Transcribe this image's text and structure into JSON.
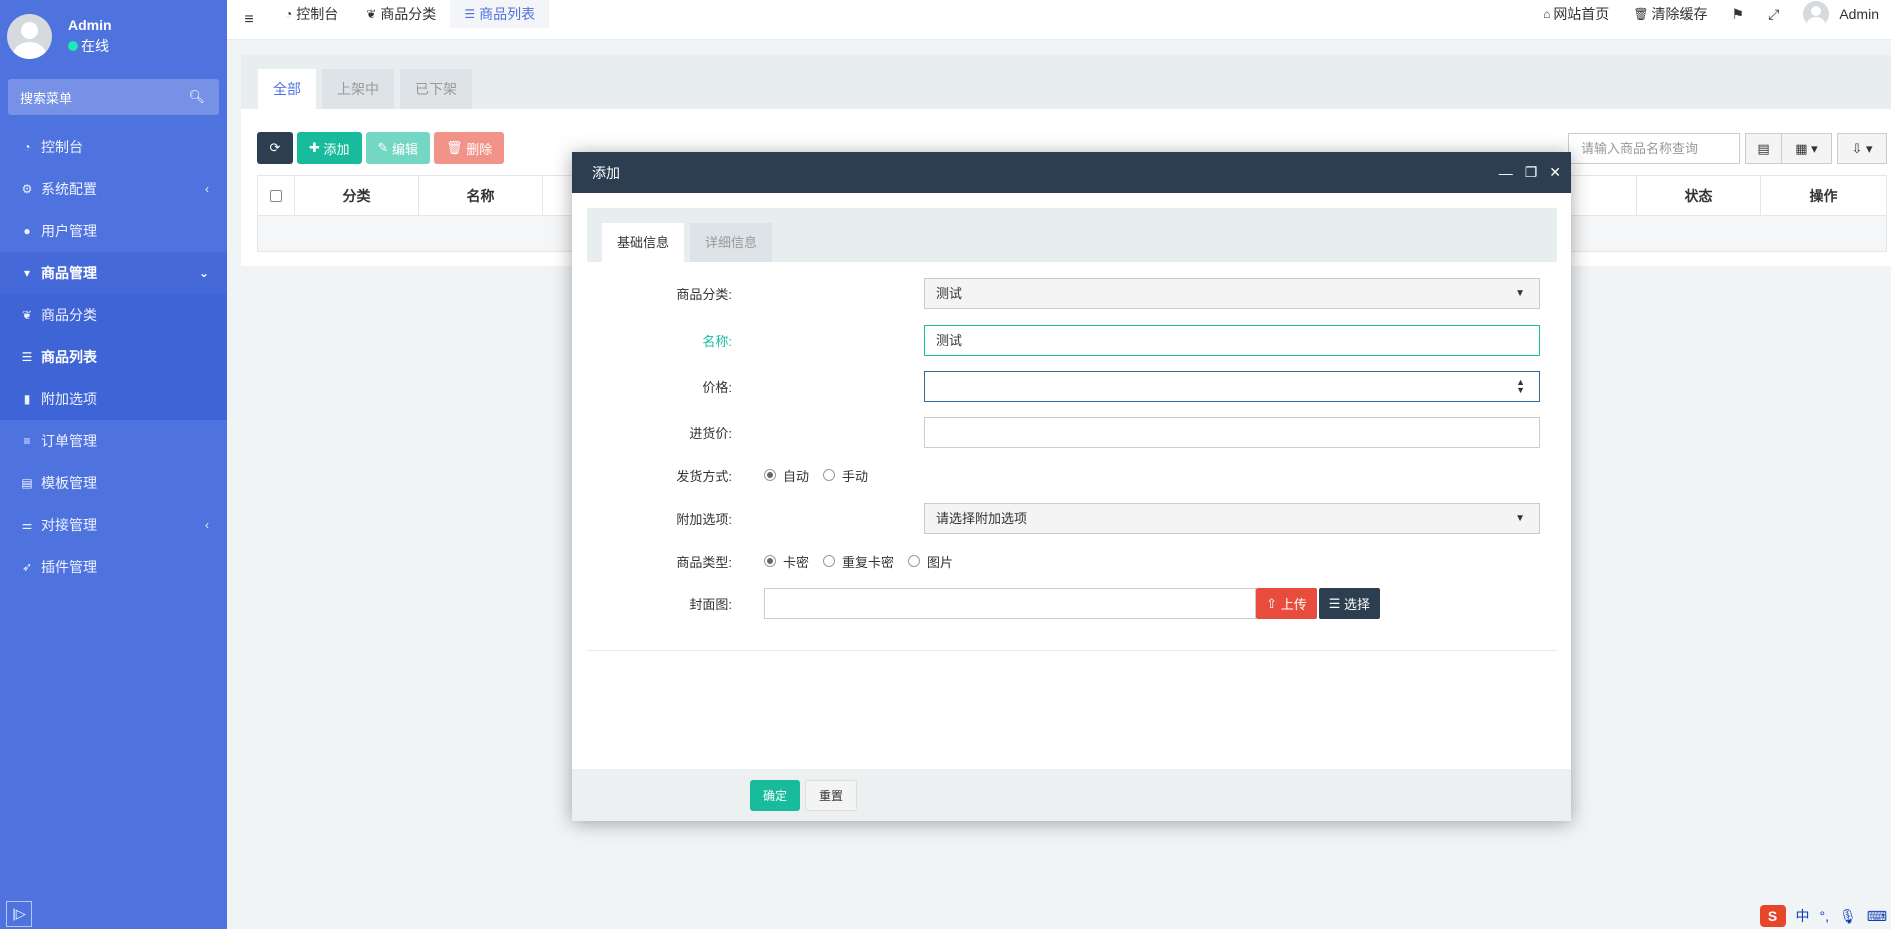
{
  "sidebar": {
    "user": {
      "name": "Admin",
      "status": "在线"
    },
    "search_placeholder": "搜索菜单",
    "items": [
      {
        "label": "控制台",
        "icon": "dashboard-icon"
      },
      {
        "label": "系统配置",
        "icon": "gear-icon"
      },
      {
        "label": "用户管理",
        "icon": "user-icon"
      },
      {
        "label": "商品管理",
        "icon": "cart-icon"
      },
      {
        "label": "商品分类",
        "icon": "leaf-icon"
      },
      {
        "label": "商品列表",
        "icon": "list-icon"
      },
      {
        "label": "附加选项",
        "icon": "bookmark-icon"
      },
      {
        "label": "订单管理",
        "icon": "bars-icon"
      },
      {
        "label": "模板管理",
        "icon": "table-icon"
      },
      {
        "label": "对接管理",
        "icon": "sliders-icon"
      },
      {
        "label": "插件管理",
        "icon": "rocket-icon"
      }
    ]
  },
  "topbar": {
    "tabs": [
      "控制台",
      "商品分类",
      "商品列表"
    ],
    "right": {
      "home": "网站首页",
      "clear_cache": "清除缓存",
      "user": "Admin"
    }
  },
  "panel": {
    "tabs": [
      "全部",
      "上架中",
      "已下架"
    ],
    "buttons": {
      "add": "添加",
      "edit": "编辑",
      "delete": "删除"
    },
    "search_placeholder": "请输入商品名称查询",
    "columns": [
      "分类",
      "名称",
      "状态",
      "操作"
    ]
  },
  "modal": {
    "title": "添加",
    "tabs": [
      "基础信息",
      "详细信息"
    ],
    "fields": {
      "category": {
        "label": "商品分类:",
        "value": "测试"
      },
      "name": {
        "label": "名称:",
        "value": "测试"
      },
      "price": {
        "label": "价格:",
        "value": ""
      },
      "cost": {
        "label": "进货价:",
        "value": ""
      },
      "delivery": {
        "label": "发货方式:",
        "options": [
          "自动",
          "手动"
        ],
        "selected": "自动"
      },
      "addon": {
        "label": "附加选项:",
        "value": "请选择附加选项"
      },
      "type": {
        "label": "商品类型:",
        "options": [
          "卡密",
          "重复卡密",
          "图片"
        ],
        "selected": "卡密"
      },
      "cover": {
        "label": "封面图:",
        "upload": "上传",
        "choose": "选择"
      }
    },
    "footer": {
      "confirm": "确定",
      "reset": "重置"
    }
  },
  "ime": {
    "logo": "S",
    "lang": "中",
    "punct": "°,"
  }
}
